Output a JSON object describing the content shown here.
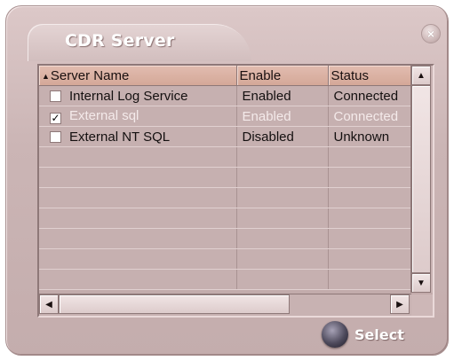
{
  "window": {
    "title": "CDR Server",
    "close_label": "×"
  },
  "table": {
    "sort_indicator": "▲",
    "columns": [
      "Server Name",
      "Enable",
      "Status"
    ],
    "rows": [
      {
        "checked": false,
        "checkmark": "",
        "name": "Internal Log Service",
        "enable": "Enabled",
        "status": "Connected",
        "selected": false
      },
      {
        "checked": true,
        "checkmark": "✓",
        "name": "External sql",
        "enable": "Enabled",
        "status": "Connected",
        "selected": true
      },
      {
        "checked": false,
        "checkmark": "",
        "name": "External NT SQL",
        "enable": "Disabled",
        "status": "Unknown",
        "selected": false
      }
    ]
  },
  "scrollbars": {
    "up_icon": "▲",
    "down_icon": "▼",
    "left_icon": "◀",
    "right_icon": "▶"
  },
  "footer": {
    "select_label": "Select"
  },
  "colors": {
    "window_bg": "#cbb5b5",
    "header_bg": "#d4a898",
    "selected_text": "#f4eaea"
  }
}
